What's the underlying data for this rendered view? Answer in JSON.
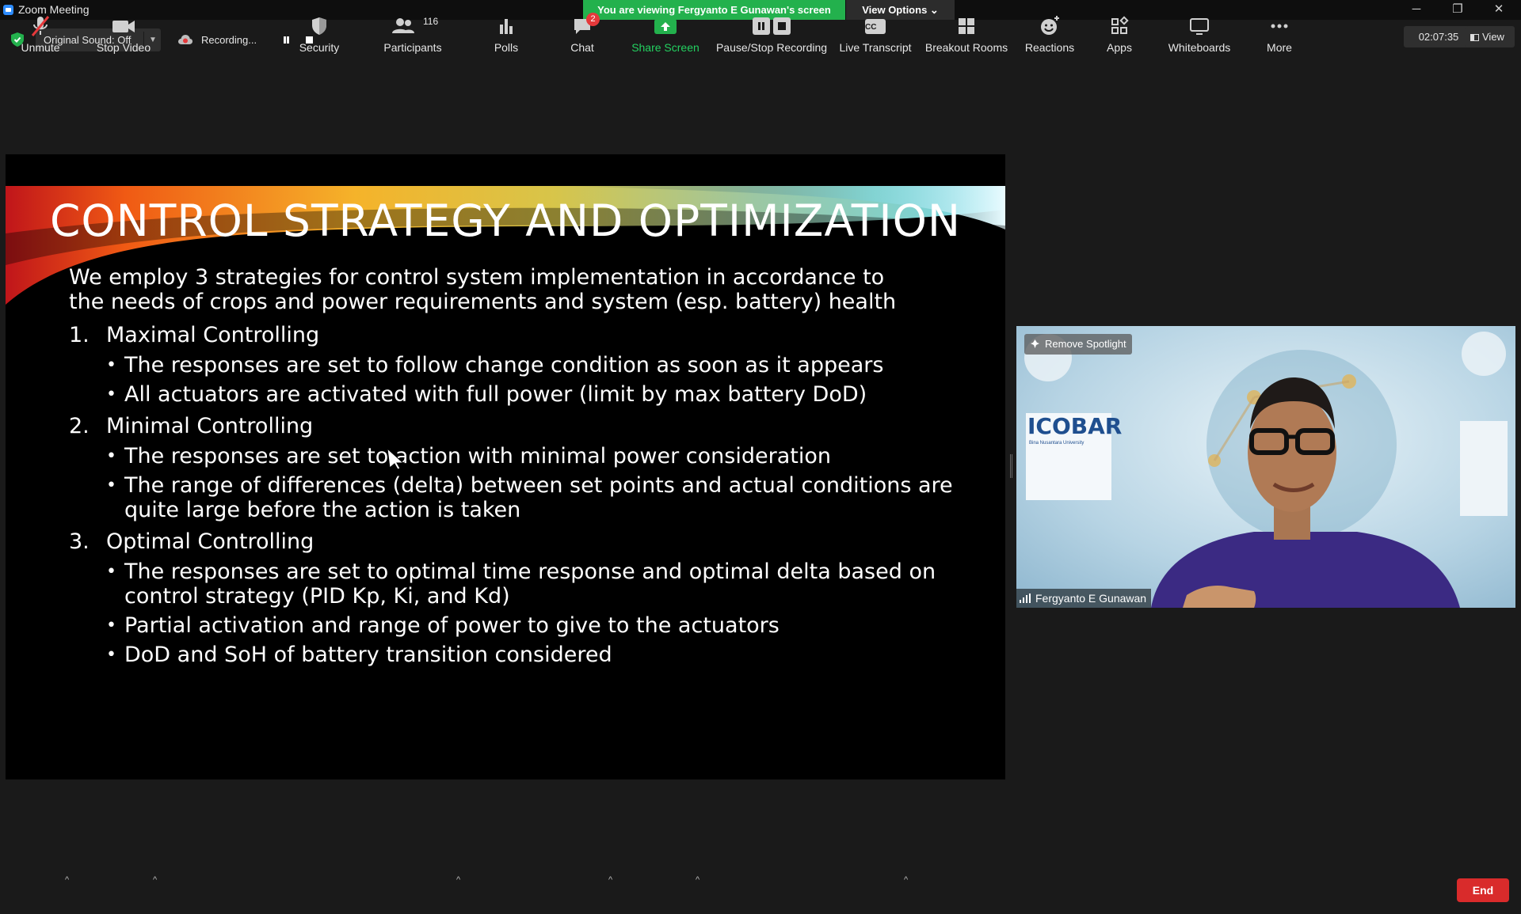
{
  "window": {
    "title": "Zoom Meeting",
    "viewing_banner": "You are viewing Fergyanto E Gunawan's screen",
    "view_options": "View Options ⌄",
    "minimize": "─",
    "restore": "❐",
    "close": "✕"
  },
  "top_toolbar": {
    "original_sound": "Original Sound: Off",
    "recording_label": "Recording...",
    "timer": "02:07:35",
    "view_label": "View"
  },
  "slide": {
    "title": "CONTROL STRATEGY AND OPTIMIZATION",
    "intro_line1": "We employ 3 strategies for control system implementation in accordance to",
    "intro_line2": "the needs of crops and power requirements and system (esp. battery) health",
    "items": [
      {
        "num": "1.",
        "heading": "Maximal Controlling",
        "bullets": [
          "The responses are set to follow change condition as soon as it appears",
          "All actuators are activated with full power (limit by max battery DoD)"
        ]
      },
      {
        "num": "2.",
        "heading": "Minimal Controlling",
        "bullets": [
          "The responses are set to action with minimal power consideration",
          "The range of differences (delta) between set points and actual conditions are quite large before the action is taken"
        ]
      },
      {
        "num": "3.",
        "heading": "Optimal Controlling",
        "bullets": [
          "The responses are set to optimal time response and optimal delta based on control strategy (PID Kp, Ki, and Kd)",
          "Partial activation and range of power to give to the actuators",
          "DoD and SoH of battery transition considered"
        ]
      }
    ]
  },
  "video": {
    "remove_spotlight": "Remove Spotlight",
    "participant_name": "Fergyanto E Gunawan",
    "backdrop_logo": "ICOBAR",
    "backdrop_subtitle": "Bina Nusantara University"
  },
  "bottom_toolbar": {
    "unmute": "Unmute",
    "stop_video": "Stop Video",
    "security": "Security",
    "participants": "Participants",
    "participants_count": "116",
    "polls": "Polls",
    "chat": "Chat",
    "chat_badge": "2",
    "share_screen": "Share Screen",
    "pause_stop_recording": "Pause/Stop Recording",
    "live_transcript": "Live Transcript",
    "cc_label": "CC",
    "breakout_rooms": "Breakout Rooms",
    "reactions": "Reactions",
    "apps": "Apps",
    "whiteboards": "Whiteboards",
    "more": "More",
    "end": "End"
  },
  "colors": {
    "banner_green": "#23b14d",
    "share_green": "#23d160",
    "end_red": "#d92b2b",
    "mute_red": "#e5393b"
  }
}
